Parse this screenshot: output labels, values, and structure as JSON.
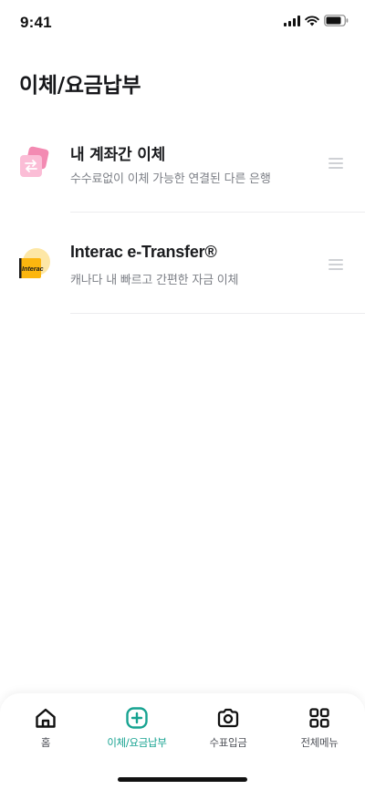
{
  "status_bar": {
    "time": "9:41"
  },
  "header": {
    "title": "이체/요금납부"
  },
  "menu": {
    "items": [
      {
        "title": "내 계좌간 이체",
        "subtitle": "수수료없이 이체 가능한 연결된 다른 은행",
        "icon": "account-transfer-icon"
      },
      {
        "title": "Interac e-Transfer®",
        "subtitle": "캐나다 내 빠르고 간편한 자금 이체",
        "icon": "interac-logo-icon",
        "logo_text": "Interac"
      }
    ]
  },
  "bottom_nav": {
    "items": [
      {
        "label": "홈",
        "icon": "home-icon",
        "active": false
      },
      {
        "label": "이체/요금납부",
        "icon": "transfer-plus-icon",
        "active": true
      },
      {
        "label": "수표입금",
        "icon": "camera-icon",
        "active": false
      },
      {
        "label": "전체메뉴",
        "icon": "grid-menu-icon",
        "active": false
      }
    ]
  },
  "colors": {
    "accent": "#17a391",
    "text_primary": "#1a1b1e",
    "text_secondary": "#7c7f86",
    "transfer_icon_pink": "#f58db4",
    "interac_yellow": "#fcb60f"
  }
}
